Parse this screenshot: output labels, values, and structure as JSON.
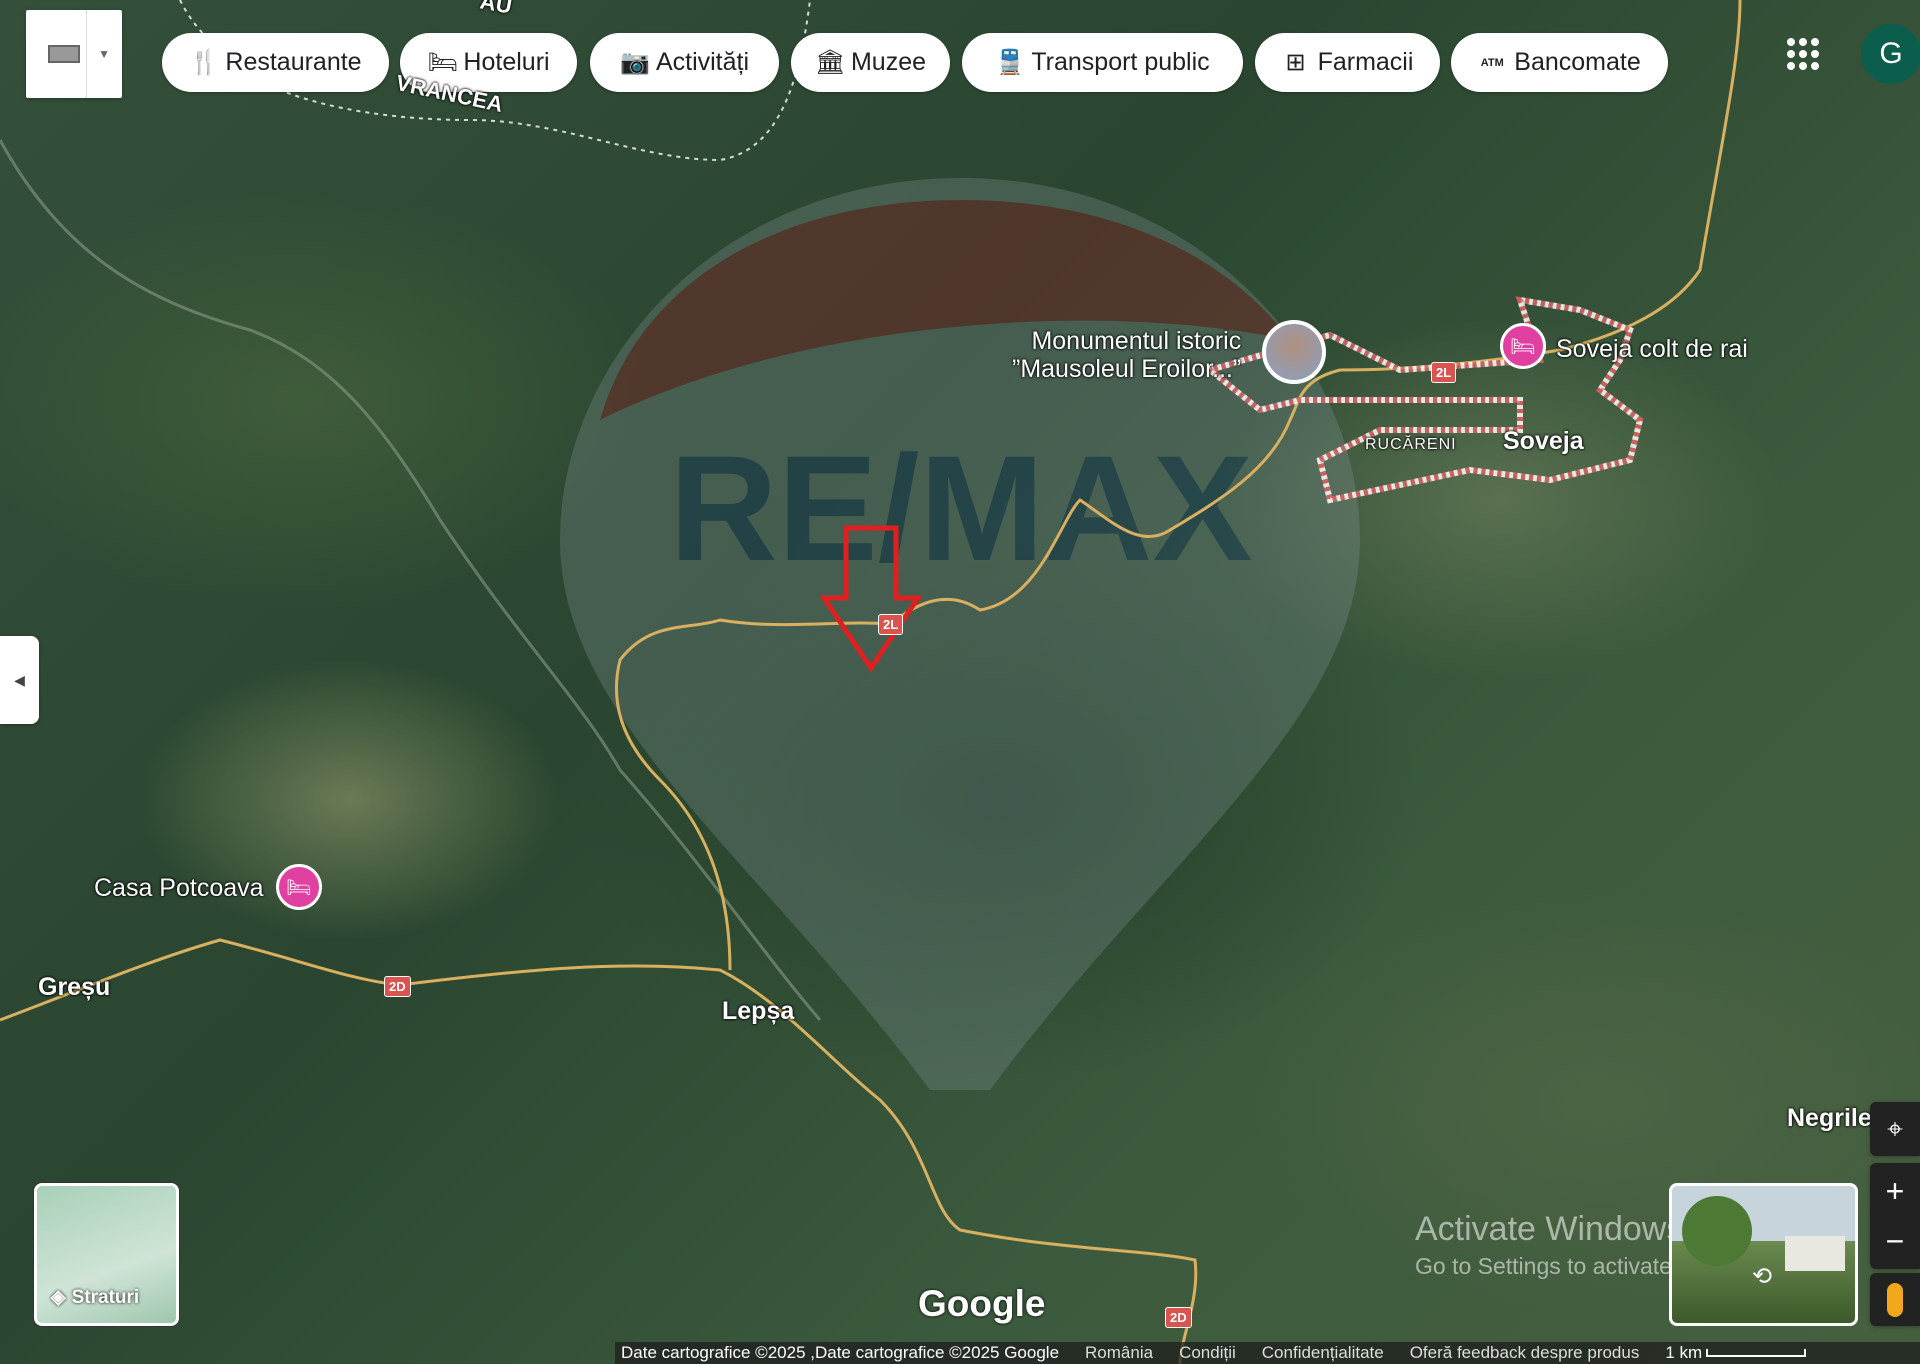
{
  "toolbar": {
    "keyboard_icon": "keyboard-icon",
    "chips": [
      {
        "label": "Restaurante",
        "icon": "fork-knife-icon"
      },
      {
        "label": "Hoteluri",
        "icon": "bed-icon"
      },
      {
        "label": "Activități",
        "icon": "camera-icon"
      },
      {
        "label": "Muzee",
        "icon": "museum-icon"
      },
      {
        "label": "Transport public",
        "icon": "train-icon"
      },
      {
        "label": "Farmacii",
        "icon": "pharmacy-icon"
      },
      {
        "label": "Bancomate",
        "icon": "atm-icon"
      }
    ]
  },
  "account": {
    "initial": "G",
    "color": "#0b5e4b"
  },
  "map": {
    "places": {
      "monument_line1": "Monumentul istoric",
      "monument_line2": "”Mausoleul Eroilor...”",
      "soveja_colt": "Soveja colt de rai",
      "soveja": "Soveja",
      "rucareni": "RUCĂRENI",
      "casa_potcoava": "Casa Potcoava",
      "gresu": "Greșu",
      "lepsa": "Lepșa",
      "negrile": "Negrile",
      "top_label": "VRANCEA",
      "top_label2": "ĂU"
    },
    "roads": {
      "r1": "2L",
      "r2": "2L",
      "r3": "2D",
      "r4": "2D"
    },
    "pin_color": "#e040a0",
    "marker_color": "#e02020",
    "watermark": "RE/MAX"
  },
  "controls": {
    "layers_label": "Straturi",
    "google_logo": "Google"
  },
  "windows": {
    "line1": "Activate Windows",
    "line2": "Go to Settings to activate Windows."
  },
  "footer": {
    "data": "Date cartografice ©2025 ,Date cartografice ©2025 Google",
    "country": "România",
    "terms": "Condiții",
    "privacy": "Confidențialitate",
    "feedback": "Oferă feedback despre produs",
    "scale": "1 km"
  }
}
